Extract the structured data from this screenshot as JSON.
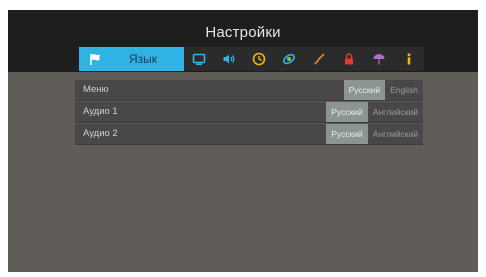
{
  "header": {
    "title": "Настройки"
  },
  "tabs": {
    "active_label": "Язык",
    "icons": [
      "monitor-icon",
      "speaker-icon",
      "clock-icon",
      "globe-icon",
      "brush-icon",
      "lock-icon",
      "umbrella-icon",
      "info-icon"
    ]
  },
  "colors": {
    "active_tab": "#2fb3e4",
    "selected_option": "#8d9592",
    "accent_green": "#8bc34a",
    "accent_yellow": "#f2b705",
    "accent_red": "#e53935"
  },
  "settings": {
    "rows": [
      {
        "label": "Меню",
        "options": [
          "Русский",
          "English"
        ],
        "selected": 0
      },
      {
        "label": "Аудио 1",
        "options": [
          "Русский",
          "Английский"
        ],
        "selected": 0
      },
      {
        "label": "Аудио 2",
        "options": [
          "Русский",
          "Английский"
        ],
        "selected": 0
      }
    ]
  }
}
